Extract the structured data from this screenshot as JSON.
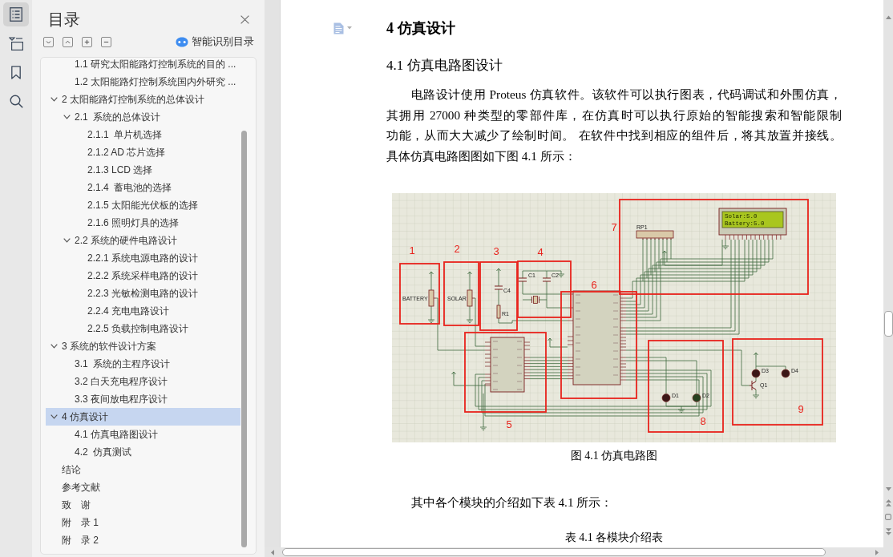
{
  "rail": [
    {
      "selected": true
    },
    {
      "selected": false
    },
    {
      "selected": false
    },
    {
      "selected": false
    }
  ],
  "toc_panel": {
    "title": "目录",
    "smart_button": "智能识别目录",
    "items": [
      {
        "children": [
          {
            "label": "1.1 研究太阳能路灯控制系统的目的 ...",
            "selected": false
          },
          {
            "label": "1.2 太阳能路灯控制系统国内外研究 ...",
            "selected": false
          }
        ]
      },
      {
        "label": "2 太阳能路灯控制系统的总体设计",
        "expanded": true,
        "selected": false,
        "children": [
          {
            "label": "2.1  系统的总体设计",
            "expanded": true,
            "selected": false,
            "children": [
              {
                "label": "2.1.1  单片机选择",
                "selected": false
              },
              {
                "label": "2.1.2 AD 芯片选择",
                "selected": false
              },
              {
                "label": "2.1.3 LCD 选择",
                "selected": false
              },
              {
                "label": "2.1.4  蓄电池的选择",
                "selected": false
              },
              {
                "label": "2.1.5 太阳能光伏板的选择",
                "selected": false
              },
              {
                "label": "2.1.6 照明灯具的选择",
                "selected": false
              }
            ]
          },
          {
            "label": "2.2 系统的硬件电路设计",
            "expanded": true,
            "selected": false,
            "children": [
              {
                "label": "2.2.1 系统电源电路的设计",
                "selected": false
              },
              {
                "label": "2.2.2 系统采样电路的设计",
                "selected": false
              },
              {
                "label": "2.2.3 光敏检测电路的设计",
                "selected": false
              },
              {
                "label": "2.2.4 充电电路设计",
                "selected": false
              },
              {
                "label": "2.2.5 负载控制电路设计",
                "selected": false
              }
            ]
          }
        ]
      },
      {
        "label": "3 系统的软件设计方案",
        "expanded": true,
        "selected": false,
        "children": [
          {
            "label": "3.1  系统的主程序设计",
            "selected": false
          },
          {
            "label": "3.2 白天充电程序设计",
            "selected": false
          },
          {
            "label": "3.3 夜间放电程序设计",
            "selected": false
          }
        ]
      },
      {
        "label": "4 仿真设计",
        "expanded": true,
        "selected": true,
        "children": [
          {
            "label": "4.1 仿真电路图设计",
            "selected": false
          },
          {
            "label": "4.2  仿真测试",
            "selected": false
          }
        ]
      },
      {
        "label": "结论",
        "selected": false
      },
      {
        "label": "参考文献",
        "selected": false
      },
      {
        "label": "致　谢",
        "selected": false
      },
      {
        "label": "附　录 1",
        "selected": false
      },
      {
        "label": "附　录 2",
        "selected": false
      }
    ]
  },
  "document": {
    "heading": "4 仿真设计",
    "subheading": "4.1 仿真电路图设计",
    "paragraph_lines": [
      "电路设计使用 Proteus 仿真软件。该软件可以执行图表，代码调试和外围仿真，",
      "其拥用 27000 种类型的零部件库，在仿真时可以执行原始的智能搜索和智能限制",
      "功能，从而大大减少了绘制时间。 在软件中找到相应的组件后，将其放置并接线。",
      "具体仿真电路图图如下图 4.1 所示："
    ],
    "figure": {
      "module_numbers": [
        "1",
        "2",
        "3",
        "4",
        "5",
        "6",
        "7",
        "8",
        "9"
      ],
      "lcd_lines": [
        "Solar:5.0",
        "Battery:5.0"
      ],
      "component_labels": [
        "BATTERY",
        "SOLAR",
        "C4",
        "R1",
        "C1",
        "C2",
        "RP1",
        "D1",
        "D2",
        "D3",
        "D4",
        "Q1"
      ]
    },
    "figure_caption": "图 4.1 仿真电路图",
    "paragraph_2": "其中各个模块的介绍如下表 4.1 所示：",
    "table_caption": "表 4.1 各模块介绍表"
  }
}
